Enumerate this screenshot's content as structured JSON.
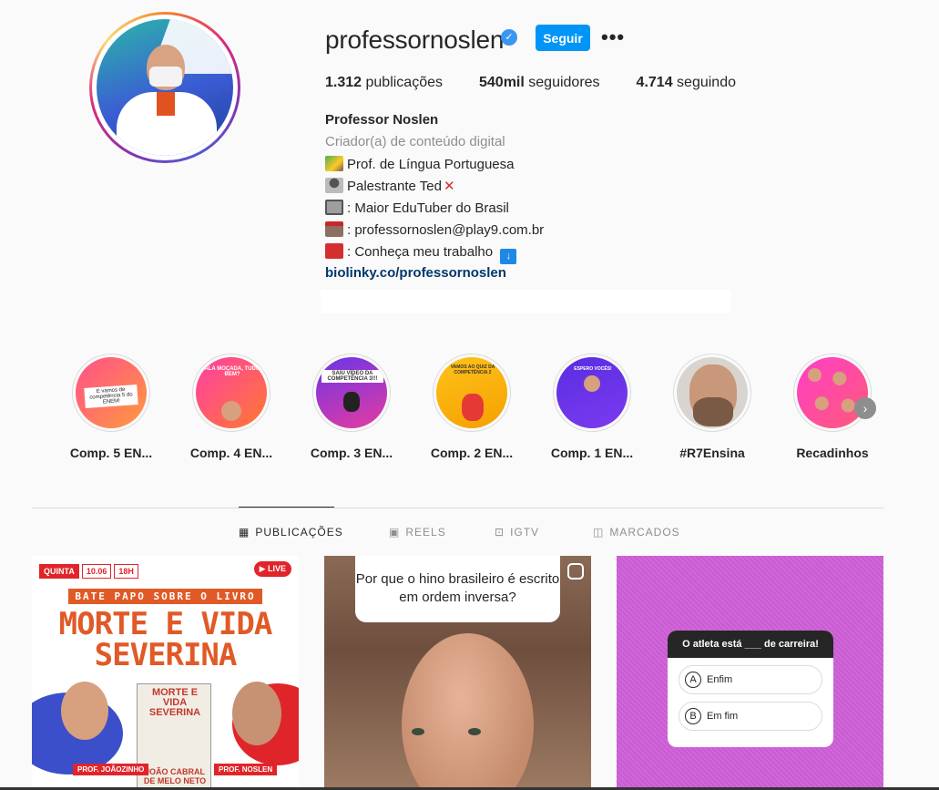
{
  "profile": {
    "username": "professornoslen",
    "follow_label": "Seguir",
    "more_label": "•••",
    "stats": {
      "posts_count": "1.312",
      "posts_label": "publicações",
      "followers_count": "540mil",
      "followers_label": "seguidores",
      "following_count": "4.714",
      "following_label": "seguindo"
    },
    "full_name": "Professor Noslen",
    "category": "Criador(a) de conteúdo digital",
    "bio": [
      "Prof. de Língua Portuguesa",
      "Palestrante Ted",
      ": Maior EduTuber do Brasil",
      ": professornoslen@play9.com.br",
      ": Conheça meu trabalho"
    ],
    "link": "biolinky.co/professornoslen"
  },
  "highlights": [
    {
      "label": "Comp. 5 EN...",
      "colors": [
        "#ff4f8b",
        "#ff9a3c"
      ],
      "text": "E vamos de competência 5 do ENEM!"
    },
    {
      "label": "Comp. 4 EN...",
      "colors": [
        "#ff3ea5",
        "#ff7a2f"
      ],
      "text": "ALA MOÇADA, TUDO BEM?"
    },
    {
      "label": "Comp. 3 EN...",
      "colors": [
        "#6a35e8",
        "#e63ba0"
      ],
      "text": "SAIU VÍDEO DA COMPETÊNCIA 3!!!"
    },
    {
      "label": "Comp. 2 EN...",
      "colors": [
        "#ffc21a",
        "#f5a000"
      ],
      "text": "VAMOS AO QUIZ DA COMPETÊNCIA 2"
    },
    {
      "label": "Comp. 1 EN...",
      "colors": [
        "#5a2de0",
        "#7b3bf0"
      ],
      "text": "ESPERO VOCÊS!"
    },
    {
      "label": "#R7Ensina",
      "colors": [
        "#d8d4cf",
        "#8b6e57"
      ],
      "text": ""
    },
    {
      "label": "Recadinhos",
      "colors": [
        "#ff3ec8",
        "#ff5a78"
      ],
      "text": ""
    }
  ],
  "tabs": [
    {
      "label": "PUBLICAÇÕES",
      "icon": "grid-icon",
      "active": true
    },
    {
      "label": "REELS",
      "icon": "reels-icon",
      "active": false
    },
    {
      "label": "IGTV",
      "icon": "igtv-icon",
      "active": false
    },
    {
      "label": "MARCADOS",
      "icon": "tagged-icon",
      "active": false
    }
  ],
  "posts": {
    "p1": {
      "day": "QUINTA",
      "date": "10.06",
      "time": "18H",
      "live": "LIVE",
      "subtitle": "BATE PAPO SOBRE O LIVRO",
      "title_line1": "MORTE E VIDA",
      "title_line2": "SEVERINA",
      "book_title": "MORTE E VIDA SEVERINA",
      "book_author": "JOÃO CABRAL DE MELO NETO",
      "guest1": "PROF. JOÃOZINHO",
      "guest2": "PROF. NOSLEN"
    },
    "p2": {
      "question": "Por que o hino brasileiro é escrito em ordem inversa?"
    },
    "p3": {
      "question": "O atleta está ___ de carreira!",
      "option_a_letter": "A",
      "option_a": "Enfim",
      "option_b_letter": "B",
      "option_b": "Em fim"
    }
  }
}
